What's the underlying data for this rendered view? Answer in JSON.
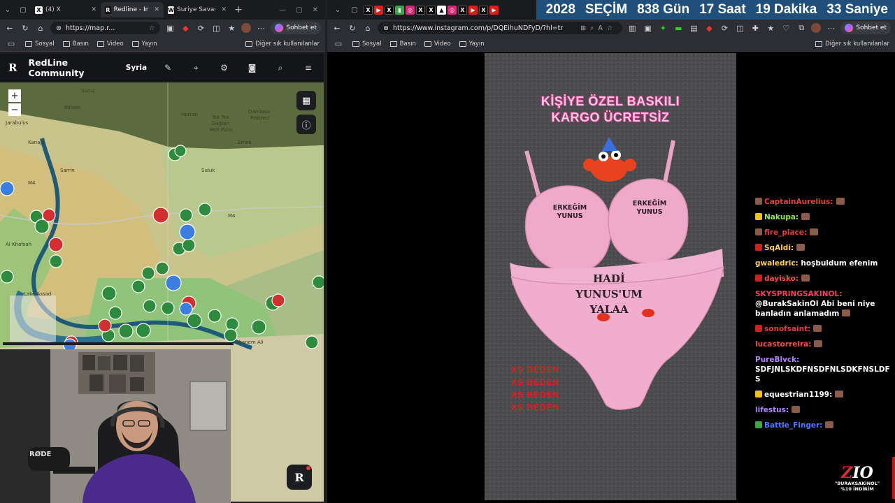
{
  "left_browser": {
    "tabs": [
      {
        "label": "(4) X",
        "icon": "x-logo"
      },
      {
        "label": "Redline - Inter",
        "icon": "redline-logo",
        "active": true
      },
      {
        "label": "Suriye Savaş H",
        "icon": "w-logo"
      }
    ],
    "url": "https://map.r...",
    "copilot_label": "Sohbet et",
    "bookmarks": [
      "Sosyal",
      "Basın",
      "Video",
      "Yayın"
    ],
    "other_bookmarks": "Diğer sık kullanılanlar"
  },
  "redline": {
    "logo": "R",
    "title": "RedLine Community",
    "region": "Syria",
    "zoom_in": "+",
    "zoom_out": "−",
    "float_logo": "R",
    "map_labels": {
      "suruc": "Suruç",
      "kobani": "Kobani",
      "harran": "Harran",
      "tek_tek": "Tek Tek",
      "daglari": "Dağları",
      "milli_parki": "Milli Parkı",
      "damlasu": "Damlasu",
      "pekmez": "Pekmez",
      "emek": "Emek",
      "jarabulus": "Jarabulus",
      "kanaja": "Kanaja",
      "sarrin": "Sarrin",
      "m4": "M4",
      "suluk": "Suluk",
      "al_khafsah": "Al Khafsah",
      "lake_assad": "Lake Assad",
      "ghanem_ali": "Ghanem Ali",
      "road_m4_east": "M4"
    }
  },
  "right_browser": {
    "url": "https://www.instagram.com/p/DQEihuNDFyD/?hl=tr",
    "copilot_label": "Sohbet et",
    "bookmarks": [
      "Sosyal",
      "Basın",
      "Video",
      "Yayın"
    ],
    "other_bookmarks": "Diğer sık kullanılanlar",
    "countdown": [
      "2028",
      "SEÇİM",
      "838 Gün",
      "17 Saat",
      "19 Dakika",
      "33 Saniye"
    ]
  },
  "post": {
    "headline_1": "KİŞİYE ÖZEL BASKILI",
    "headline_2": "KARGO ÜCRETSİZ",
    "cup_left": "ERKEĞİM YUNUS",
    "cup_right": "ERKEĞİM YUNUS",
    "panty_1": "HADİ",
    "panty_2": "YUNUS'UM",
    "panty_3": "YALAA",
    "sizes": [
      "XS BEDEN",
      "XS BEDEN",
      "XS BEDEN",
      "XS BEDEN"
    ]
  },
  "chat": {
    "messages": [
      {
        "user": "CaptainAurelius:",
        "text": "",
        "color": "#e83b3b",
        "badge": "#8a5a4a",
        "emote": true
      },
      {
        "user": "Nakupa:",
        "text": "",
        "color": "#9ae65a",
        "badge": "#f0c020",
        "emote": true
      },
      {
        "user": "fire_place:",
        "text": "",
        "color": "#e83b3b",
        "badge": "#8a5a4a",
        "emote": true
      },
      {
        "user": "SqAldi:",
        "text": "",
        "color": "#ffd24a",
        "badge": "#d02020",
        "emote": true
      },
      {
        "user": "gwaledric:",
        "text": "hoşbuldum efenim",
        "color": "#ffd24a",
        "badge": "",
        "emote": false
      },
      {
        "user": "dayisko:",
        "text": "",
        "color": "#ff4a4a",
        "badge": "#d02020",
        "emote": true
      },
      {
        "user": "SKYSPRINGSAKINOL:",
        "text": "@BurakSakinOl Abi beni niye banladın anlamadım",
        "color": "#ff3b5c",
        "badge": "",
        "emote": true
      },
      {
        "user": "sonofsaint:",
        "text": "",
        "color": "#e83b3b",
        "badge": "#d02020",
        "emote": true
      },
      {
        "user": "lucastorreira:",
        "text": "",
        "color": "#ff4a4a",
        "badge": "",
        "emote": true
      },
      {
        "user": "PureBlvck:",
        "text": "SDFJNLSKDFNSDFNLSDKFNSLDFS",
        "color": "#b084ff",
        "badge": "",
        "emote": false
      },
      {
        "user": "equestrian1199:",
        "text": "",
        "color": "#ffffff",
        "badge": "#f0c020",
        "emote": true
      },
      {
        "user": "lifestus:",
        "text": "",
        "color": "#b084ff",
        "badge": "",
        "emote": true
      },
      {
        "user": "Battle_Finger:",
        "text": "",
        "color": "#4a7aff",
        "badge": "#3aa84a",
        "emote": true
      }
    ]
  },
  "sponsor": {
    "logo_z": "Z",
    "logo_rest": "IO",
    "line1": "\"BURAKSAKINOL\"",
    "line2": "%10 İNDİRİM"
  }
}
